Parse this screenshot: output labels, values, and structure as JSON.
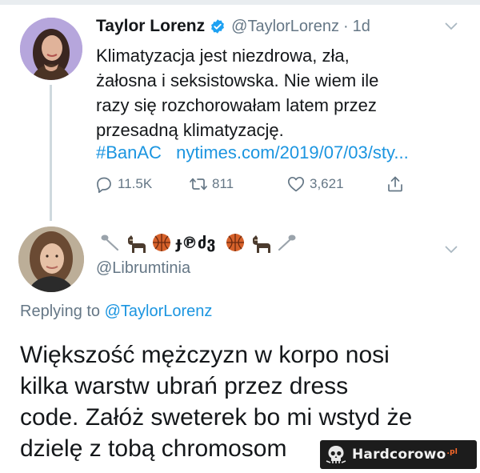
{
  "tweet": {
    "author_name": "Taylor Lorenz",
    "author_handle": "@TaylorLorenz",
    "separator": "·",
    "time": "1d",
    "text_lines": [
      "Klimatyzacja jest niezdrowa, zła,",
      "żałosna i seksistowska. Nie wiem ile",
      "razy się rozchorowałam latem przez",
      "przesadną klimatyzację."
    ],
    "hashtag": "#BanAC",
    "link": "nytimes.com/2019/07/03/sty...",
    "stats": {
      "replies": "11.5K",
      "retweets": "811",
      "likes": "3,621"
    }
  },
  "reply": {
    "author_handle": "@Librumtinia",
    "replying_prefix": "Replying to",
    "replying_mention": "@TaylorLorenz",
    "text_lines": [
      "Większość mężczyzn w korpo nosi",
      "kilka warstw ubrań przez dress",
      "code. Załóż sweterek bo mi wstyd że",
      "dzielę z tobą chromosom"
    ]
  },
  "watermark": {
    "brand": "Hardcorowo",
    "suffix": ".pl"
  },
  "colors": {
    "link": "#1b95e0",
    "muted": "#657786",
    "text": "#14171a",
    "verified": "#1da1f2"
  },
  "icons": [
    "verified-badge-icon",
    "chevron-down-icon",
    "reply-icon",
    "retweet-icon",
    "like-heart-icon",
    "share-icon",
    "emoji-name-icons",
    "skull-logo-icon"
  ]
}
